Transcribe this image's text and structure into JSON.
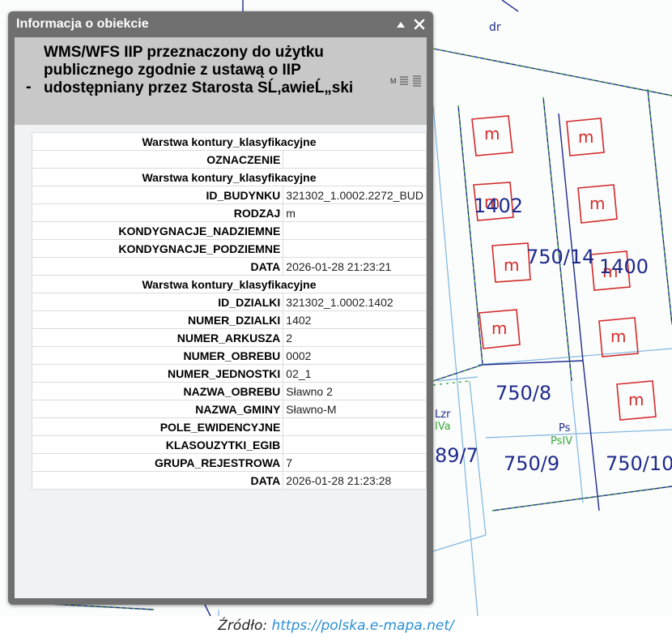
{
  "map": {
    "labels": {
      "dr": "dr",
      "p1402": "1402",
      "p750_14": "750/14",
      "p1400": "1400",
      "p750_8": "750/8",
      "p750_9": "750/9",
      "p750_10": "750/10",
      "p89_7": "89/7",
      "lzr": "Lzr",
      "iva": "IVa",
      "ps": "Ps",
      "psiv": "PsIV",
      "building_m": "m"
    },
    "colors": {
      "parcel_line": "#1f2a8c",
      "land_use_line": "#3aa63a",
      "building": "#d22a2a",
      "contour_line": "#7fb4e0"
    }
  },
  "popup": {
    "title": "Informacja o obiekcie",
    "layer_title": "WMS/WFS IIP przeznaczony do użytku publicznego zgodnie z ustawą o IIP udostępniany przez Starosta SĹ‚awieĹ„ski",
    "layer_collapse": "-",
    "tool_m": "M",
    "rows": [
      {
        "type": "header",
        "text": "Warstwa kontury_klasyfikacyjne"
      },
      {
        "type": "right",
        "text": "OZNACZENIE"
      },
      {
        "type": "header",
        "text": "Warstwa kontury_klasyfikacyjne"
      },
      {
        "type": "kv",
        "key": "ID_BUDYNKU",
        "value": "321302_1.0002.2272_BUD"
      },
      {
        "type": "kv",
        "key": "RODZAJ",
        "value": "m"
      },
      {
        "type": "kv",
        "key": "KONDYGNACJE_NADZIEMNE",
        "value": ""
      },
      {
        "type": "kv",
        "key": "KONDYGNACJE_PODZIEMNE",
        "value": ""
      },
      {
        "type": "kv",
        "key": "DATA",
        "value": "2026-01-28 21:23:21"
      },
      {
        "type": "header",
        "text": "Warstwa kontury_klasyfikacyjne"
      },
      {
        "type": "kv",
        "key": "ID_DZIALKI",
        "value": "321302_1.0002.1402"
      },
      {
        "type": "kv",
        "key": "NUMER_DZIALKI",
        "value": "1402"
      },
      {
        "type": "kv",
        "key": "NUMER_ARKUSZA",
        "value": "2"
      },
      {
        "type": "kv",
        "key": "NUMER_OBREBU",
        "value": "0002"
      },
      {
        "type": "kv",
        "key": "NUMER_JEDNOSTKI",
        "value": "02_1"
      },
      {
        "type": "kv",
        "key": "NAZWA_OBREBU",
        "value": "Sławno 2"
      },
      {
        "type": "kv",
        "key": "NAZWA_GMINY",
        "value": "Sławno-M"
      },
      {
        "type": "kv",
        "key": "POLE_EWIDENCYJNE",
        "value": ""
      },
      {
        "type": "kv",
        "key": "KLASOUZYTKI_EGIB",
        "value": ""
      },
      {
        "type": "kv",
        "key": "GRUPA_REJESTROWA",
        "value": "7"
      },
      {
        "type": "kv",
        "key": "DATA",
        "value": "2026-01-28 21:23:28"
      }
    ]
  },
  "source": {
    "prefix": "Źródło: ",
    "link": "https://polska.e-mapa.net/"
  }
}
